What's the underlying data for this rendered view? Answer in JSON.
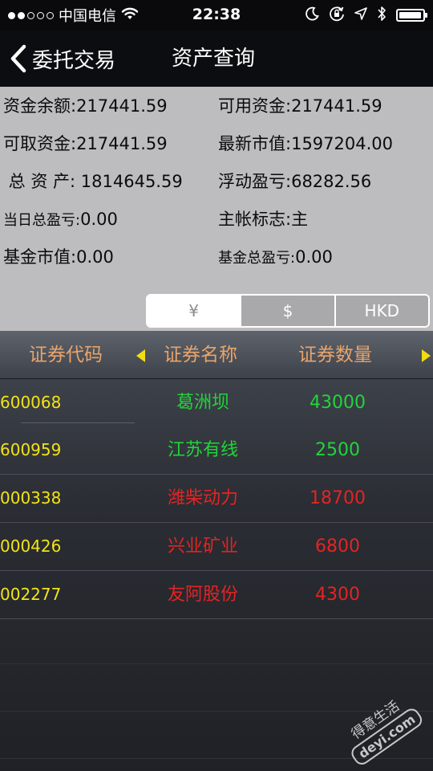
{
  "status_bar": {
    "signal_strength": {
      "filled": 2,
      "total": 5
    },
    "carrier": "中国电信",
    "wifi_icon": "wifi-icon",
    "time": "22:38",
    "icons": [
      "moon-icon",
      "rotation-lock-icon",
      "location-arrow-icon",
      "bluetooth-icon",
      "battery-icon"
    ],
    "battery_level": 0.95
  },
  "nav": {
    "back_icon": "chevron-left-icon",
    "back_label": "委托交易",
    "title": "资产查询"
  },
  "summary": {
    "rows": [
      {
        "left_label": "资金余额:",
        "left_value": "217441.59",
        "right_label": "可用资金:",
        "right_value": "217441.59"
      },
      {
        "left_label": "可取资金:",
        "left_value": "217441.59",
        "right_label": "最新市值:",
        "right_value": "1597204.00"
      },
      {
        "left_label": " 总 资 产:",
        "left_value": " 1814645.59",
        "right_label": "浮动盈亏:",
        "right_value": "68282.56"
      },
      {
        "left_label": "当日总盈亏:",
        "left_value": "0.00",
        "right_label": "主帐标志:",
        "right_value": "主"
      },
      {
        "left_label": "基金市值:",
        "left_value": "0.00",
        "right_label": "基金总盈亏:",
        "right_value": "0.00"
      }
    ]
  },
  "currency_tabs": [
    {
      "label": "¥",
      "selected": true
    },
    {
      "label": "$",
      "selected": false
    },
    {
      "label": "HKD",
      "selected": false
    }
  ],
  "table": {
    "columns": [
      "证券代码",
      "证券名称",
      "证券数量"
    ],
    "left_arrow_icon": "triangle-left-icon",
    "right_arrow_icon": "triangle-right-icon",
    "rows": [
      {
        "code": "600068",
        "name": "葛洲坝",
        "quantity": "43000",
        "status": "gain"
      },
      {
        "code": "600959",
        "name": "江苏有线",
        "quantity": "2500",
        "status": "gain"
      },
      {
        "code": "000338",
        "name": "潍柴动力",
        "quantity": "18700",
        "status": "loss"
      },
      {
        "code": "000426",
        "name": "兴业矿业",
        "quantity": "6800",
        "status": "loss"
      },
      {
        "code": "002277",
        "name": "友阿股份",
        "quantity": "4300",
        "status": "loss"
      }
    ]
  },
  "colors": {
    "gain": "#22d43a",
    "loss": "#e32424",
    "code": "#f2e315",
    "header_text": "#e9a46a",
    "summary_bg": "#bdbdbf"
  },
  "watermark": {
    "line1": "得意生活",
    "line2": "deyi.com"
  }
}
